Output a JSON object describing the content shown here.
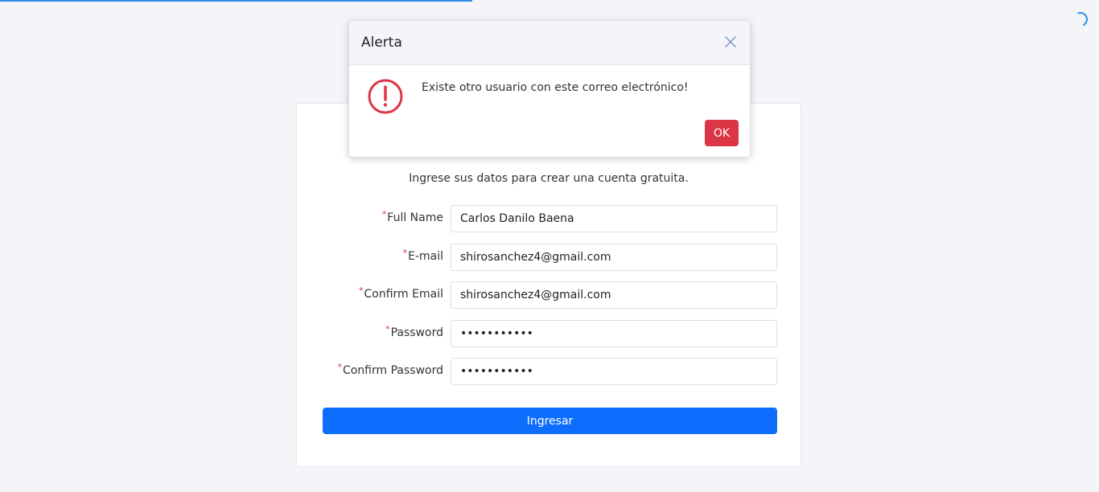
{
  "form": {
    "subtitle": "Ingrese sus datos para crear una cuenta gratuita.",
    "required_mark": "*",
    "fields": [
      {
        "label": "Full Name",
        "value": "Carlos Danilo Baena"
      },
      {
        "label": "E-mail",
        "value": "shirosanchez4@gmail.com"
      },
      {
        "label": "Confirm Email",
        "value": "shirosanchez4@gmail.com"
      },
      {
        "label": "Password",
        "value": "•••••••••••"
      },
      {
        "label": "Confirm Password",
        "value": "•••••••••••"
      }
    ],
    "submit_label": "Ingresar"
  },
  "modal": {
    "title": "Alerta",
    "message": "Existe otro usuario con este correo electrónico!",
    "ok_label": "OK"
  },
  "colors": {
    "primary": "#0d6efd",
    "danger": "#dc3545",
    "progress": "#2e8be8"
  },
  "icons": {
    "close": "close-icon",
    "alert": "exclamation-circle-icon",
    "loading": "loading-spinner-icon"
  }
}
